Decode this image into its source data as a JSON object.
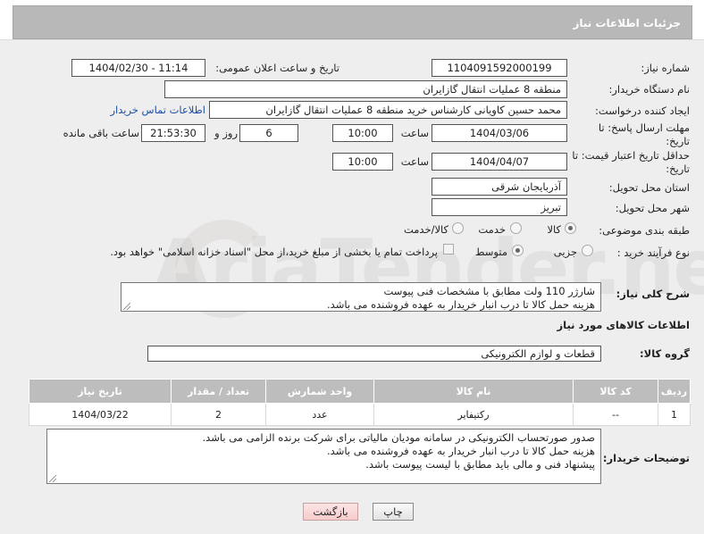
{
  "header": {
    "title": "جزئیات اطلاعات نیاز"
  },
  "form": {
    "need_number": {
      "label": "شماره نیاز:",
      "value": "1104091592000199"
    },
    "announce_datetime": {
      "label": "تاریخ و ساعت اعلان عمومی:",
      "value": "1404/02/30 - 11:14"
    },
    "buyer_org": {
      "label": "نام دستگاه خریدار:",
      "value": "منطقه 8 عملیات انتقال گازایران"
    },
    "requester": {
      "label": "ایجاد کننده درخواست:",
      "value": "محمد حسین کاویانی کارشناس خرید منطقه 8 عملیات انتقال گازایران",
      "contact_link": "اطلاعات تماس خریدار"
    },
    "reply_deadline": {
      "label": "مهلت ارسال پاسخ: تا تاریخ:",
      "date": "1404/03/06",
      "time_label": "ساعت",
      "time": "10:00",
      "days": "6",
      "days_label": "روز و",
      "remaining": "21:53:30",
      "remaining_label": "ساعت باقی مانده"
    },
    "price_validity": {
      "label": "حداقل تاریخ اعتبار قیمت: تا تاریخ:",
      "date": "1404/04/07",
      "time_label": "ساعت",
      "time": "10:00"
    },
    "province": {
      "label": "استان محل تحویل:",
      "value": "آذربایجان شرقی"
    },
    "city": {
      "label": "شهر محل تحویل:",
      "value": "تبریز"
    },
    "category": {
      "label": "طبقه بندی موضوعی:",
      "options": [
        "کالا",
        "خدمت",
        "کالا/خدمت"
      ],
      "selected": "کالا"
    },
    "process_type": {
      "label": "نوع فرآیند خرید :",
      "options": [
        "جزیی",
        "متوسط"
      ],
      "selected": "متوسط",
      "payment_note": "پرداخت تمام یا بخشی از مبلغ خرید،از محل \"اسناد خزانه اسلامی\" خواهد بود."
    },
    "description": {
      "label": "شرح کلی نیاز:",
      "lines": [
        "شارژر 110 ولت مطابق با مشخصات فنی پیوست",
        "هزینه حمل کالا تا درب انبار خریدار به عهده فروشنده می باشد."
      ]
    }
  },
  "goods_section": {
    "title": "اطلاعات کالاهای مورد نیاز",
    "group_label": "گروه کالا:",
    "group_value": "قطعات و لوازم الکترونیکی",
    "columns": [
      "ردیف",
      "کد کالا",
      "نام کالا",
      "واحد شمارش",
      "تعداد / مقدار",
      "تاریخ نیاز"
    ],
    "rows": [
      [
        "1",
        "--",
        "رکتیفایر",
        "عدد",
        "2",
        "1404/03/22"
      ]
    ]
  },
  "buyer_notes": {
    "label": "توضیحات خریدار:",
    "lines": [
      "صدور صورتحساب الکترونیکی در سامانه مودیان مالیاتی برای شرکت برنده الزامی می باشد.",
      "هزینه حمل کالا تا درب انبار خریدار به عهده فروشنده می باشد.",
      "پیشنهاد فنی و مالی باید مطابق با لیست پیوست باشد."
    ]
  },
  "buttons": {
    "print": "چاپ",
    "back": "بازگشت"
  },
  "watermark": "AriaTender.net"
}
